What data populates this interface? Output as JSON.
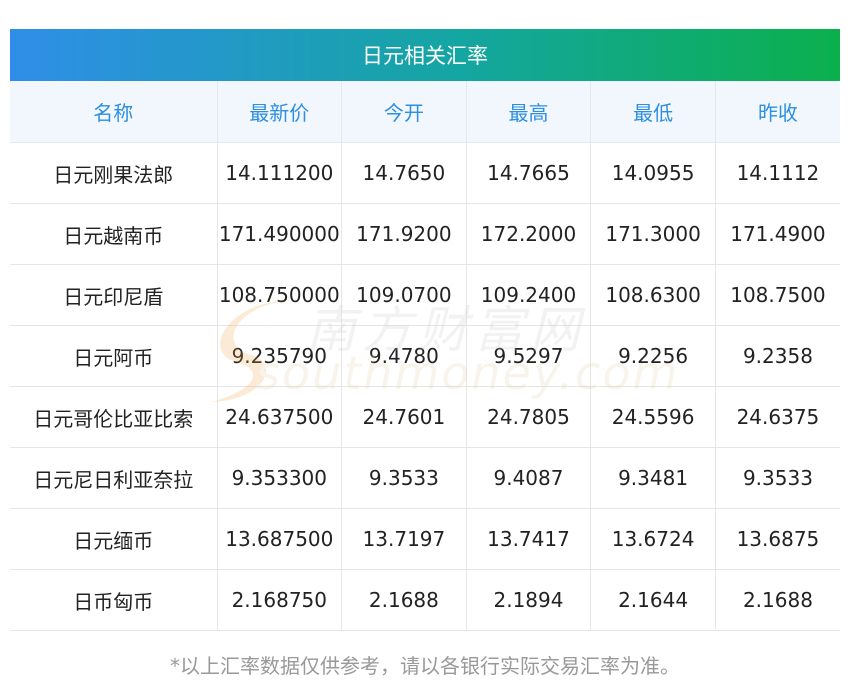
{
  "title": "日元相关汇率",
  "table": {
    "headers": [
      "名称",
      "最新价",
      "今开",
      "最高",
      "最低",
      "昨收"
    ],
    "rows": [
      [
        "日元刚果法郎",
        "14.111200",
        "14.7650",
        "14.7665",
        "14.0955",
        "14.1112"
      ],
      [
        "日元越南币",
        "171.490000",
        "171.9200",
        "172.2000",
        "171.3000",
        "171.4900"
      ],
      [
        "日元印尼盾",
        "108.750000",
        "109.0700",
        "109.2400",
        "108.6300",
        "108.7500"
      ],
      [
        "日元阿币",
        "9.235790",
        "9.4780",
        "9.5297",
        "9.2256",
        "9.2358"
      ],
      [
        "日元哥伦比亚比索",
        "24.637500",
        "24.7601",
        "24.7805",
        "24.5596",
        "24.6375"
      ],
      [
        "日元尼日利亚奈拉",
        "9.353300",
        "9.3533",
        "9.4087",
        "9.3481",
        "9.3533"
      ],
      [
        "日元缅币",
        "13.687500",
        "13.7197",
        "13.7417",
        "13.6724",
        "13.6875"
      ],
      [
        "日币匈币",
        "2.168750",
        "2.1688",
        "2.1894",
        "2.1644",
        "2.1688"
      ]
    ]
  },
  "watermark": {
    "cn": "南方财富网",
    "en": "southmoney.com"
  },
  "footnote": "*以上汇率数据仅供参考，请以各银行实际交易汇率为准。",
  "colors": {
    "gradient_start": "#2f8ee8",
    "gradient_end": "#0bb04c",
    "header_text": "#2c8fe0",
    "header_bg": "#f2f7fd"
  }
}
